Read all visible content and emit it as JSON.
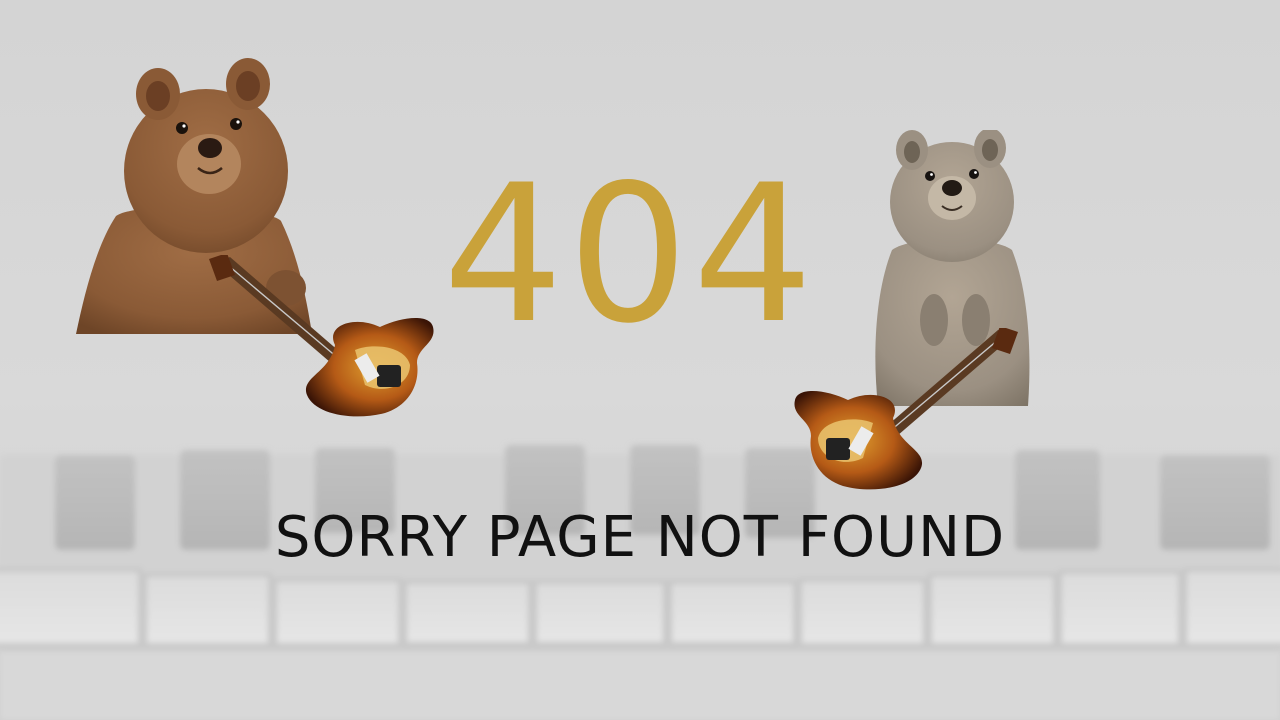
{
  "page": {
    "error_code": "404",
    "error_message": "SORRY PAGE NOT FOUND"
  },
  "colors": {
    "background": "#d6d6d6",
    "code": "#c9a23a",
    "message": "#111111",
    "quokka_left_fur": "#8a5a36",
    "quokka_right_fur": "#9b9082",
    "guitar_body": "#7a3410"
  },
  "illustrations": {
    "left": "quokka-with-electric-guitar",
    "right": "quokka-with-electric-guitar",
    "background": "faded-piano-keys"
  }
}
